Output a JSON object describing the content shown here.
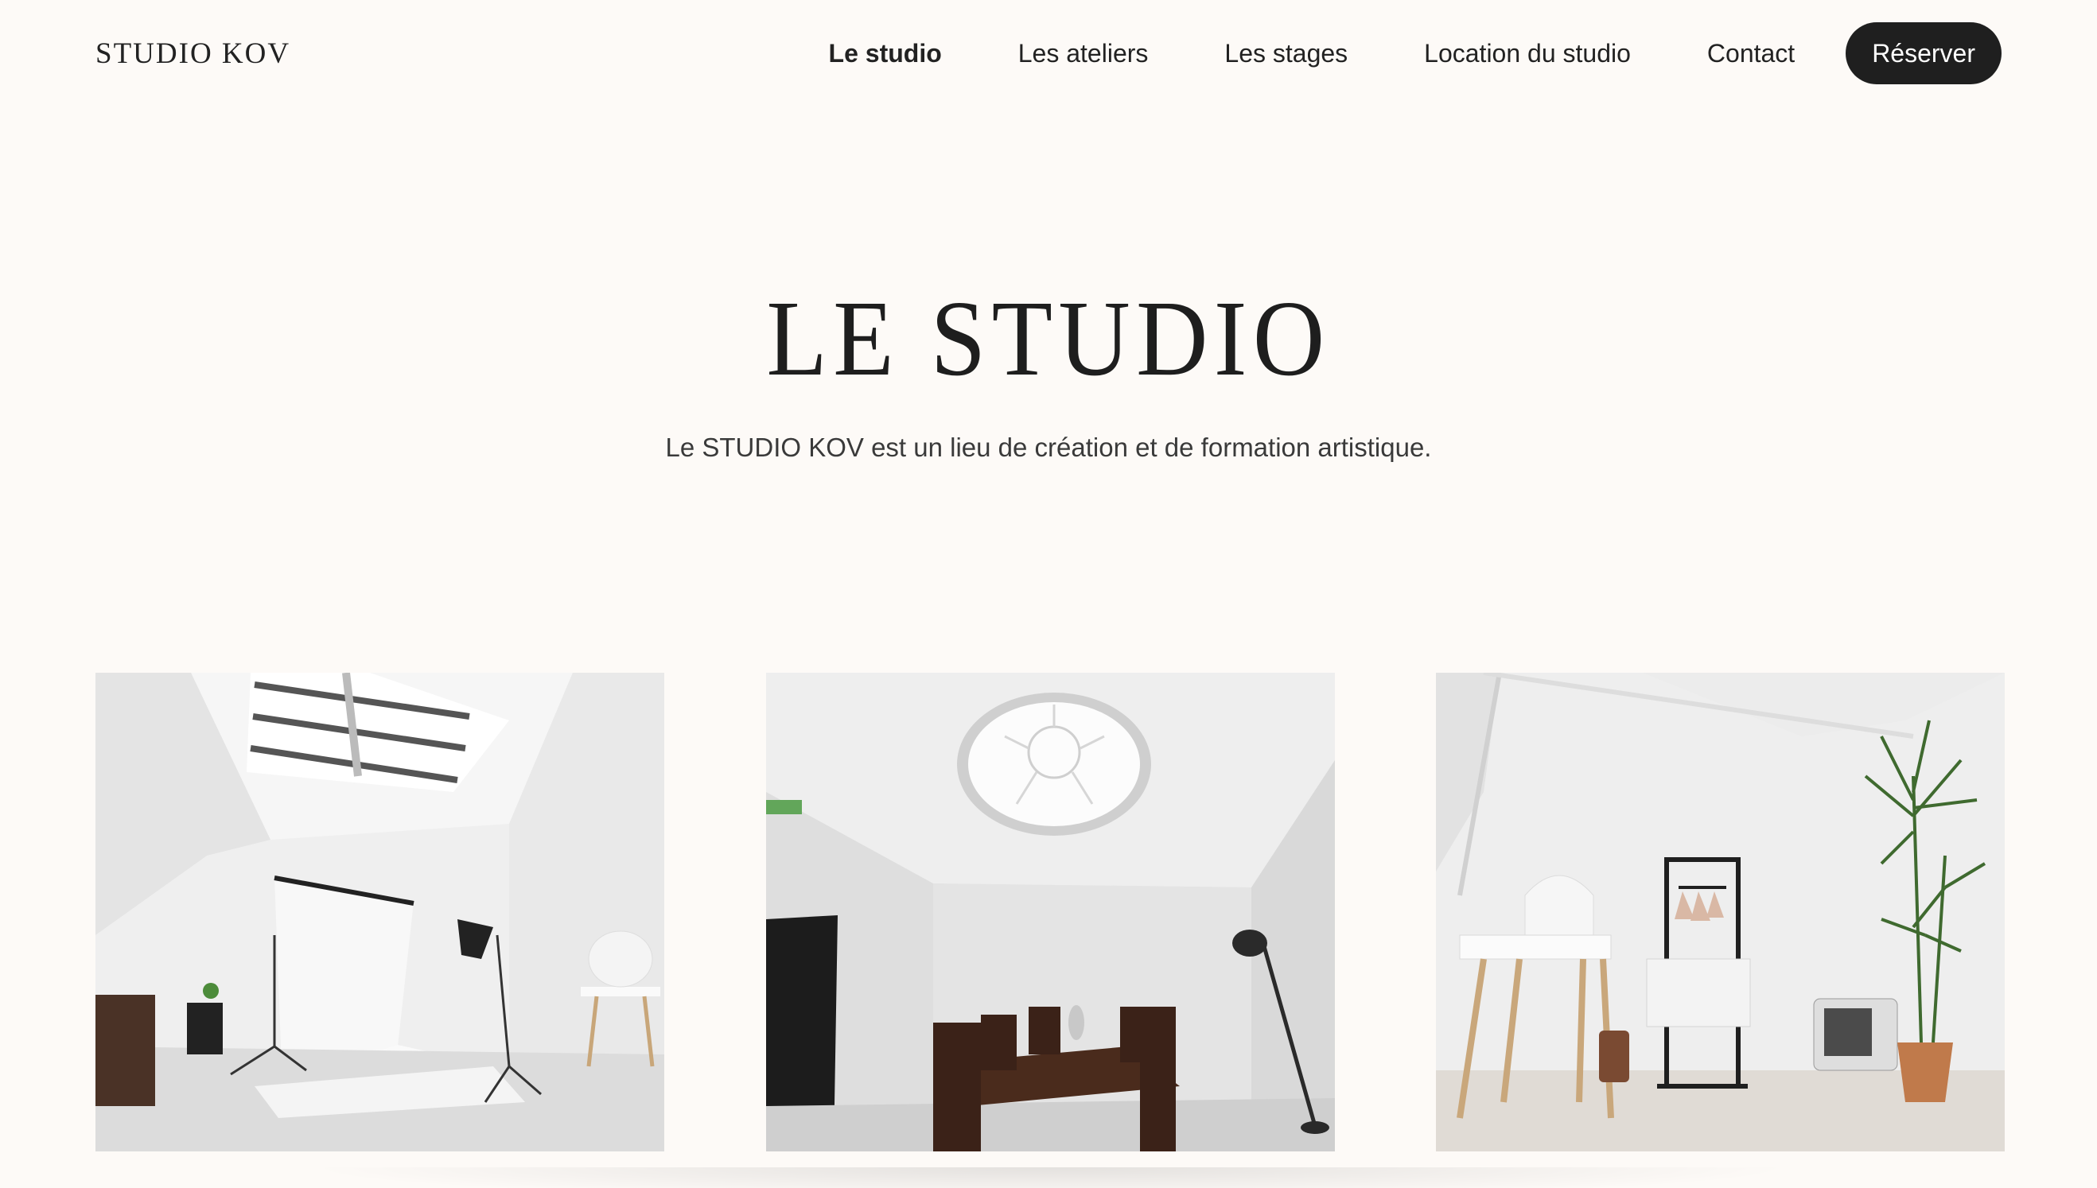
{
  "header": {
    "logo": "STUDIO KOV",
    "nav": [
      {
        "label": "Le studio",
        "active": true
      },
      {
        "label": "Les ateliers"
      },
      {
        "label": "Les stages"
      },
      {
        "label": "Location du studio"
      },
      {
        "label": "Contact"
      }
    ],
    "cta_label": "Réserver"
  },
  "hero": {
    "title": "LE STUDIO",
    "subtitle": "Le STUDIO KOV est un lieu de création et de formation artistique."
  },
  "colors": {
    "background": "#fdfaf7",
    "text": "#1e1e1e",
    "button_bg": "#1f1f1f",
    "button_text": "#ffffff"
  }
}
